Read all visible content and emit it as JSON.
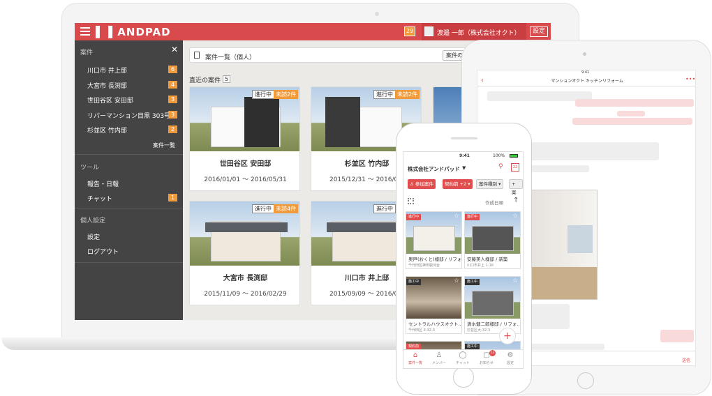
{
  "brand": {
    "name": "ANDPAD",
    "accent": "#d94a4d",
    "badge": "#f19a3b"
  },
  "desktop": {
    "notifications": "29",
    "user_name": "渡邉 一郎（株式会社オクト）",
    "settings_button": "設定",
    "sidebar": {
      "projects_section": "案件",
      "projects": [
        {
          "label": "川口市 井上邸",
          "count": "6"
        },
        {
          "label": "大宮市 長渕邸",
          "count": "4"
        },
        {
          "label": "世田谷区 安田邸",
          "count": "3"
        },
        {
          "label": "リバーマンション目黒 303号…",
          "count": "3"
        },
        {
          "label": "杉並区 竹内邸",
          "count": "2"
        }
      ],
      "projects_list_link": "案件一覧",
      "tools_section": "ツール",
      "tools": [
        {
          "label": "報告・日報",
          "count": ""
        },
        {
          "label": "チャット",
          "count": "1"
        }
      ],
      "personal_section": "個人設定",
      "personal": [
        {
          "label": "設定"
        },
        {
          "label": "ログアウト"
        }
      ]
    },
    "breadcrumb": "案件一覧（個人）",
    "breadcrumb_button": "案件の",
    "recent_label": "直近の案件",
    "recent_count": "5",
    "cards": [
      {
        "name": "世田谷区 安田邸",
        "dates": "2016/01/01 〜 2016/05/31",
        "status": "進行中",
        "unread": "未読2件"
      },
      {
        "name": "杉並区 竹内邸",
        "dates": "2015/12/31 〜 2016/05/",
        "status": "進行中",
        "unread": "未読2件"
      },
      {
        "name": "大宮市 長渕邸",
        "dates": "2015/11/09 〜 2016/02/29",
        "status": "進行中",
        "unread": "未読4件"
      },
      {
        "name": "川口市 井上邸",
        "dates": "2015/09/09 〜 2016/02/",
        "status": "進行中",
        "unread": ""
      }
    ]
  },
  "tablet": {
    "title": "マンションオクト キッチンリフォーム",
    "time": "9:41",
    "send": "送信"
  },
  "phone": {
    "time": "9:41",
    "battery": "100%",
    "company": "株式会社アンドパッド",
    "filters": [
      "参加案件",
      "契約前 +2",
      "案件種別",
      "+ 案"
    ],
    "sort_label": "作成日順",
    "cards": [
      {
        "status": "進行中",
        "title": "奥戸(おくと)様邸 / リフォ…",
        "addr": "千代田区神田駿河台"
      },
      {
        "status": "進行中",
        "title": "安藤美人様邸 / 新築",
        "addr": "川口市井上 1-18"
      },
      {
        "status": "施工中",
        "title": "セントラルハウスオクト…",
        "addr": "千代田区 3-32-3"
      },
      {
        "status": "施工中",
        "title": "清水健二郎様邸 / リフォ…",
        "addr": "杉並区大-32-3"
      },
      {
        "status": "契約前",
        "title": "",
        "addr": ""
      },
      {
        "status": "施工中",
        "title": "",
        "addr": ""
      }
    ],
    "tabs": [
      {
        "label": "案件一覧",
        "icon": "home-icon"
      },
      {
        "label": "メンバー",
        "icon": "people-icon"
      },
      {
        "label": "チャット",
        "icon": "chat-icon"
      },
      {
        "label": "お知らせ",
        "icon": "bell-icon",
        "badge": "13"
      },
      {
        "label": "設定",
        "icon": "gear-icon"
      }
    ]
  }
}
